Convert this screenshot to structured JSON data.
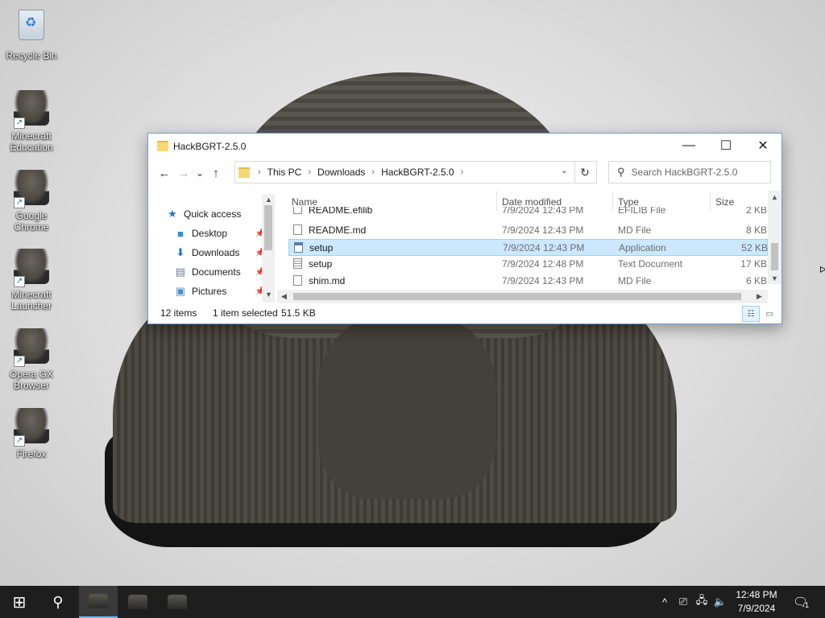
{
  "desktop": {
    "icons": [
      {
        "label": "Recycle Bin"
      },
      {
        "label": "Minecraft Education"
      },
      {
        "label": "Google Chrome"
      },
      {
        "label": "Minecraft Launcher"
      },
      {
        "label": "Opera GX Browser"
      },
      {
        "label": "Firefox"
      }
    ]
  },
  "window": {
    "title": "HackBGRT-2.5.0",
    "controls": {
      "minimize": "—",
      "maximize": "☐",
      "close": "✕"
    },
    "nav": {
      "back": "←",
      "forward": "→",
      "recent": "⌄",
      "up": "↑"
    },
    "address": {
      "crumbs": [
        "This PC",
        "Downloads",
        "HackBGRT-2.5.0"
      ],
      "separator": "›",
      "dropdown": "⌄"
    },
    "refresh": "↻",
    "search": {
      "placeholder": "Search HackBGRT-2.5.0",
      "icon": "⚲"
    },
    "navpane": {
      "items": [
        {
          "label": "Quick access",
          "icon": "★",
          "icon_name": "star-icon",
          "icon_color": "#1e73c9"
        },
        {
          "label": "Desktop",
          "icon": "■",
          "icon_name": "desktop-icon",
          "icon_color": "#2b8fe0",
          "pin": "📌"
        },
        {
          "label": "Downloads",
          "icon": "⬇",
          "icon_name": "download-icon",
          "icon_color": "#1e73c9",
          "pin": "📌"
        },
        {
          "label": "Documents",
          "icon": "▤",
          "icon_name": "documents-icon",
          "icon_color": "#6d7c8a",
          "pin": "📌"
        },
        {
          "label": "Pictures",
          "icon": "▣",
          "icon_name": "pictures-icon",
          "icon_color": "#4a8fc4",
          "pin": "📌"
        }
      ]
    },
    "columns": {
      "name": "Name",
      "date": "Date modified",
      "type": "Type",
      "size": "Size",
      "sort_indicator": "^"
    },
    "files": [
      {
        "name": "README.efilib",
        "date": "7/9/2024 12:43 PM",
        "type": "EFILIB File",
        "size": "2 KB",
        "icon": "file"
      },
      {
        "name": "README.md",
        "date": "7/9/2024 12:43 PM",
        "type": "MD File",
        "size": "8 KB",
        "icon": "file"
      },
      {
        "name": "setup",
        "date": "7/9/2024 12:43 PM",
        "type": "Application",
        "size": "52 KB",
        "icon": "app",
        "selected": true
      },
      {
        "name": "setup",
        "date": "7/9/2024 12:48 PM",
        "type": "Text Document",
        "size": "17 KB",
        "icon": "text"
      },
      {
        "name": "shim.md",
        "date": "7/9/2024 12:43 PM",
        "type": "MD File",
        "size": "6 KB",
        "icon": "file"
      }
    ],
    "status": {
      "count": "12 items",
      "selection": "1 item selected",
      "size": "51.5 KB"
    }
  },
  "taskbar": {
    "start_icon": "⊞",
    "search_icon": "⚲",
    "tray_icons": {
      "chevron": "^",
      "meet": "⎚",
      "network": "🖧",
      "volume": "🔈"
    },
    "time": "12:48 PM",
    "date": "7/9/2024",
    "notifications": "1"
  },
  "colors": {
    "accent": "#0078d7",
    "selection": "#cce8ff",
    "taskbar": "#1e1e1e"
  }
}
